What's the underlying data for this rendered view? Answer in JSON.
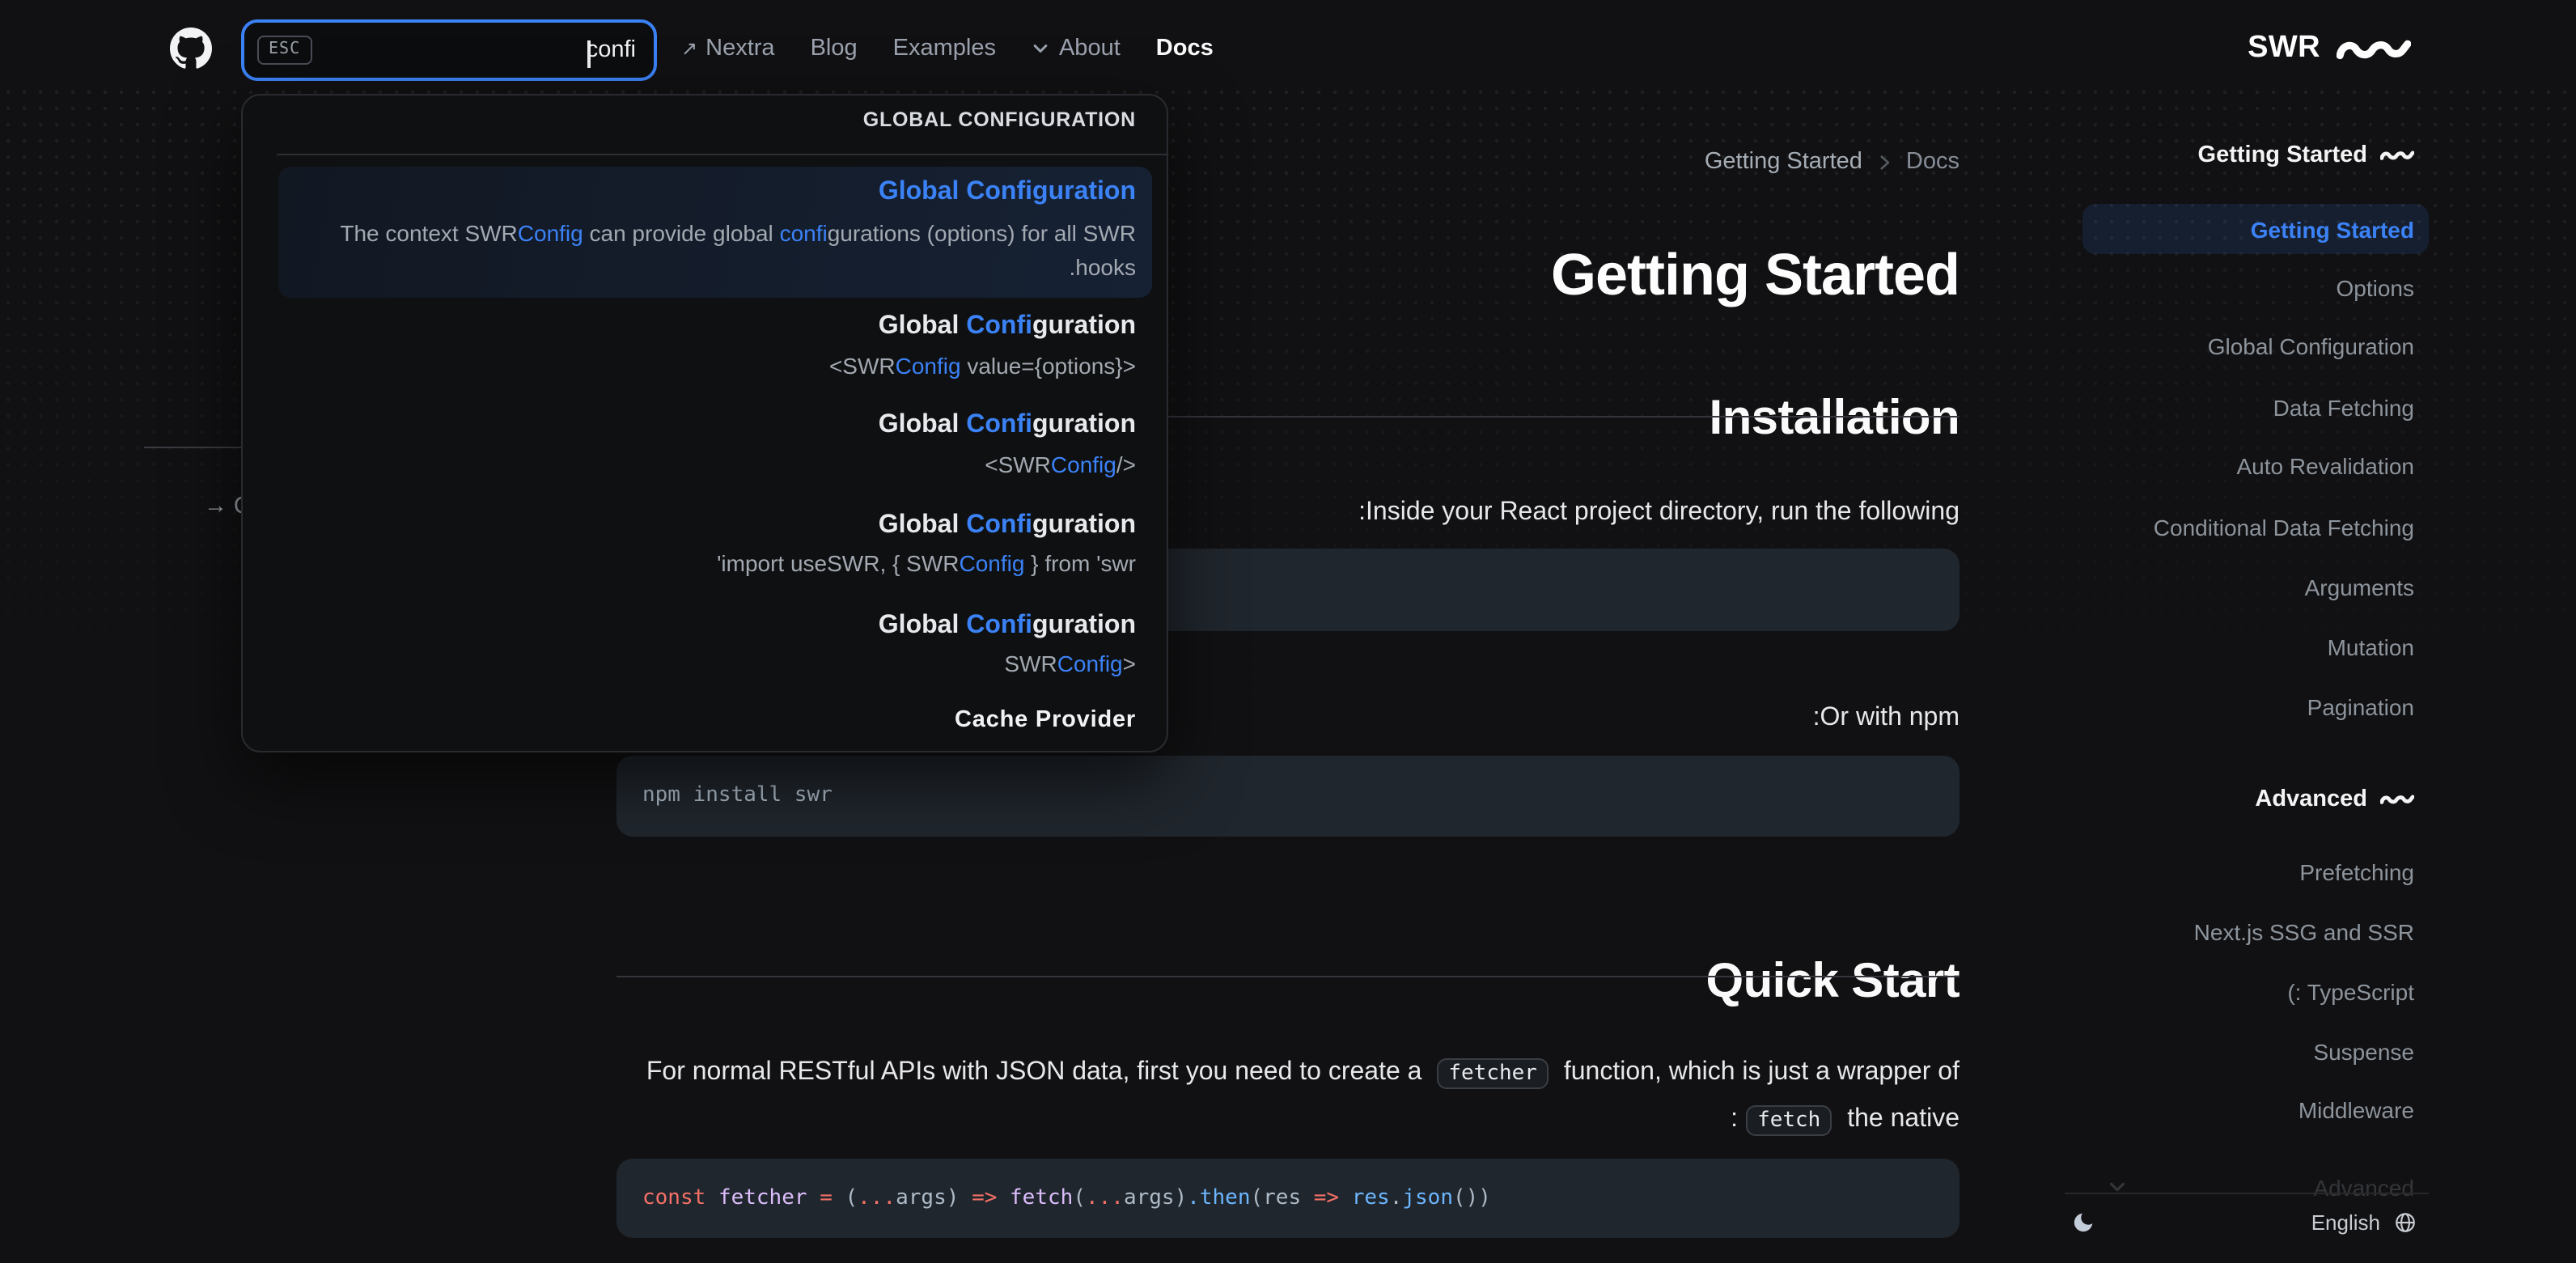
{
  "header": {
    "logo_text": "SWR",
    "nav": {
      "nextra": "Nextra",
      "blog": "Blog",
      "examples": "Examples",
      "about": "About",
      "docs": "Docs"
    }
  },
  "search": {
    "esc_label": "ESC",
    "value": "confi"
  },
  "search_dropdown": {
    "group_heading_1": "GLOBAL CONFIGURATION",
    "group_heading_2": "Cache Provider",
    "results": [
      {
        "title": [
          {
            "t": "Global Configuration",
            "hl": true
          }
        ],
        "excerpt_lines": [
          [
            {
              "t": "The context SWR"
            },
            {
              "t": "Config",
              "hl": true
            },
            {
              "t": " can provide global "
            },
            {
              "t": "confi",
              "hl": true
            },
            {
              "t": "gurations (options) for all SWR"
            }
          ],
          [
            {
              "t": ".hooks"
            }
          ]
        ]
      },
      {
        "title": [
          {
            "t": "Global "
          },
          {
            "t": "Confi",
            "hl": true
          },
          {
            "t": "guration"
          }
        ],
        "excerpt_lines": [
          [
            {
              "t": "<SWR"
            },
            {
              "t": "Config",
              "hl": true
            },
            {
              "t": " value={options}>"
            }
          ]
        ]
      },
      {
        "title": [
          {
            "t": "Global "
          },
          {
            "t": "Confi",
            "hl": true
          },
          {
            "t": "guration"
          }
        ],
        "excerpt_lines": [
          [
            {
              "t": "<SWR"
            },
            {
              "t": "Config",
              "hl": true
            },
            {
              "t": "/>"
            }
          ]
        ]
      },
      {
        "title": [
          {
            "t": "Global "
          },
          {
            "t": "Confi",
            "hl": true
          },
          {
            "t": "guration"
          }
        ],
        "excerpt_lines": [
          [
            {
              "t": "'import useSWR, { SWR"
            },
            {
              "t": "Config",
              "hl": true
            },
            {
              "t": " } from 'swr"
            }
          ]
        ]
      },
      {
        "title": [
          {
            "t": "Global "
          },
          {
            "t": "Confi",
            "hl": true
          },
          {
            "t": "guration"
          }
        ],
        "excerpt_lines": [
          [
            {
              "t": "SWR"
            },
            {
              "t": "Config",
              "hl": true
            },
            {
              "t": ">"
            }
          ]
        ]
      }
    ]
  },
  "toc_fragment": {
    "link_text": "→ Q"
  },
  "breadcrumb": {
    "current": "Getting Started",
    "parent": "Docs"
  },
  "main": {
    "page_title": "Getting Started",
    "installation_heading": "Installation",
    "installation_p1": ":Inside your React project directory, run the following",
    "installation_p2": ":Or with npm",
    "install_command": "npm install swr",
    "quickstart_heading": "Quick Start",
    "quickstart_p_line1": [
      {
        "t": "For normal RESTful APIs with JSON data, first you need to create a "
      },
      {
        "t": "fetcher",
        "chip": true
      },
      {
        "t": " function, which is just a wrapper of"
      }
    ],
    "quickstart_p_line2": [
      {
        "t": ":"
      },
      {
        "t": "fetch",
        "chip": true
      },
      {
        "t": " the native"
      }
    ],
    "fetcher_code": [
      {
        "t": "const ",
        "c": "#f47067"
      },
      {
        "t": "fetcher",
        "c": "#dcbdfb"
      },
      {
        "t": " "
      },
      {
        "t": "=",
        "c": "#f47067"
      },
      {
        "t": " ("
      },
      {
        "t": "...",
        "c": "#f47067"
      },
      {
        "t": "args"
      },
      {
        "t": ") "
      },
      {
        "t": "=>",
        "c": "#f47067"
      },
      {
        "t": " "
      },
      {
        "t": "fetch",
        "c": "#dcbdfb"
      },
      {
        "t": "("
      },
      {
        "t": "...",
        "c": "#f47067"
      },
      {
        "t": "args"
      },
      {
        "t": ")"
      },
      {
        "t": ".then",
        "c": "#6cb6ff"
      },
      {
        "t": "("
      },
      {
        "t": "res "
      },
      {
        "t": "=>",
        "c": "#f47067"
      },
      {
        "t": " "
      },
      {
        "t": "res",
        "c": "#6cb6ff"
      },
      {
        "t": "."
      },
      {
        "t": "json",
        "c": "#6cb6ff"
      },
      {
        "t": "())"
      }
    ]
  },
  "sidebar": {
    "section1_title": "Getting Started",
    "section1_items": [
      "Getting Started",
      "Options",
      "Global Configuration",
      "Data Fetching",
      "Auto Revalidation",
      "Conditional Data Fetching",
      "Arguments",
      "Mutation",
      "Pagination"
    ],
    "section2_title": "Advanced",
    "section2_items": [
      "Prefetching",
      "Next.js SSG and SSR",
      "(: TypeScript",
      "Suspense",
      "Middleware"
    ],
    "faded_item": "Advanced",
    "footer": {
      "language": "English"
    }
  },
  "colors": {
    "accent": "#3b82f6",
    "background": "#111113",
    "code_background": "#20262d"
  }
}
